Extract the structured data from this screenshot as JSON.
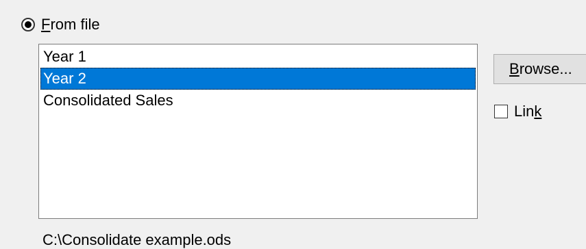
{
  "source": {
    "radio_label_mnemonic": "F",
    "radio_label_rest": "rom file",
    "selected": true
  },
  "sheet_list": {
    "items": [
      {
        "label": "Year 1",
        "selected": false
      },
      {
        "label": "Year 2",
        "selected": true
      },
      {
        "label": "Consolidated Sales",
        "selected": false
      }
    ]
  },
  "browse_button": {
    "mnemonic": "B",
    "rest": "rowse..."
  },
  "link_checkbox": {
    "label_prefix": "Lin",
    "mnemonic": "k",
    "checked": false
  },
  "file_path": "C:\\Consolidate example.ods",
  "colors": {
    "selection": "#0078d7",
    "background": "#f0f0f0"
  }
}
